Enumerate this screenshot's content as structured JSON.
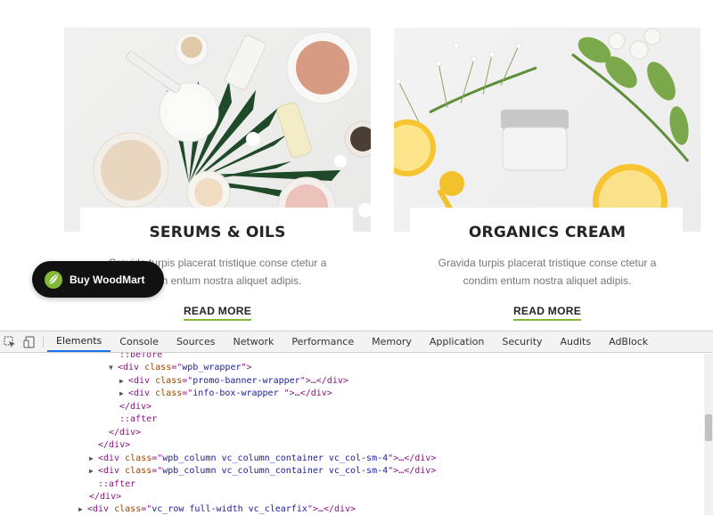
{
  "cards": [
    {
      "title": "SERUMS & OILS",
      "desc_line1": "Gravida turpis placerat tristique conse ctetur a",
      "desc_line2": "condim entum nostra aliquet adipis.",
      "read_more": "READ MORE"
    },
    {
      "title": "ORGANICS CREAM",
      "desc_line1": "Gravida turpis placerat tristique conse ctetur a",
      "desc_line2": "condim entum nostra aliquet adipis.",
      "read_more": "READ MORE"
    }
  ],
  "buy_button": {
    "label": "Buy WoodMart",
    "icon": "leaf-icon",
    "color": "#111111",
    "icon_color": "#83b735"
  },
  "accent_color": "#83b735",
  "devtools": {
    "tabs": [
      "Elements",
      "Console",
      "Sources",
      "Network",
      "Performance",
      "Memory",
      "Application",
      "Security",
      "Audits",
      "AdBlock"
    ],
    "active_tab": "Elements",
    "tools": [
      "inspect-icon",
      "device-toolbar-icon"
    ],
    "dom": [
      {
        "text_tag": "::before",
        "type": "pseudo"
      },
      {
        "tag": "div",
        "attr": "class",
        "value": "wpb_wrapper",
        "suffix": ">",
        "expanded": true
      },
      {
        "tag": "div",
        "attr": "class",
        "value": "promo-banner-wrapper",
        "suffix": ">…</div>",
        "expanded": false
      },
      {
        "tag": "div",
        "attr": "class",
        "value": "info-box-wrapper ",
        "suffix": ">…</div>",
        "expanded": false
      },
      {
        "text_tag": "</div>",
        "type": "close"
      },
      {
        "text_tag": "::after",
        "type": "pseudo"
      },
      {
        "text_tag": "</div>",
        "type": "close"
      },
      {
        "text_tag": "</div>",
        "type": "close"
      },
      {
        "tag": "div",
        "attr": "class",
        "value": "wpb_column vc_column_container vc_col-sm-4",
        "suffix": ">…</div>",
        "expanded": false
      },
      {
        "tag": "div",
        "attr": "class",
        "value": "wpb_column vc_column_container vc_col-sm-4",
        "suffix": ">…</div>",
        "expanded": false
      },
      {
        "text_tag": "::after",
        "type": "pseudo"
      },
      {
        "text_tag": "</div>",
        "type": "close"
      },
      {
        "tag": "div",
        "attr": "class",
        "value": "vc_row full-width vc_clearfix",
        "suffix": ">…</div>",
        "expanded": false
      }
    ]
  }
}
